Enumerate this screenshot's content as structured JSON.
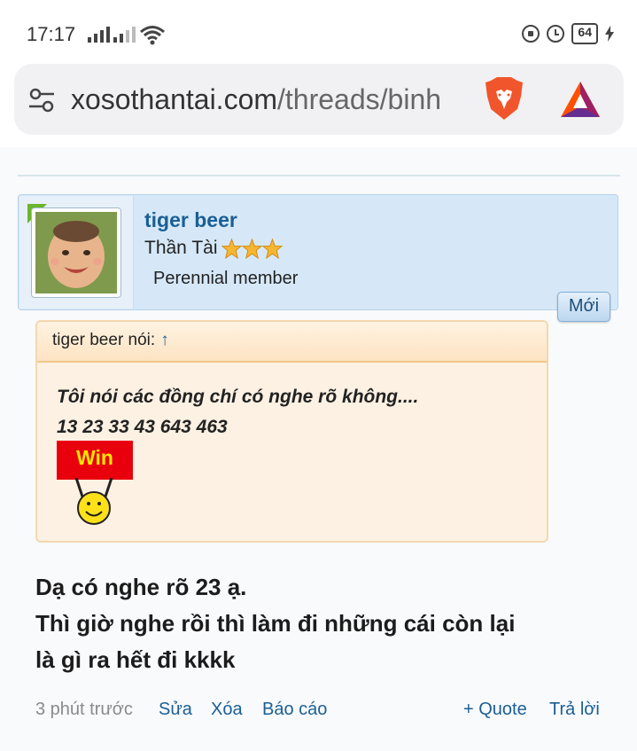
{
  "status_bar": {
    "time": "17:17",
    "battery": "64"
  },
  "browser": {
    "url_host": "xosothantai.com",
    "url_path": "/threads/binh"
  },
  "user": {
    "name": "tiger beer",
    "title": "Thần Tài",
    "star_count": 3,
    "member_type": "Perennial member",
    "new_badge": "Mới"
  },
  "quote": {
    "attribution": "tiger beer nói:",
    "arrow": "↑",
    "line1": "Tôi nói các đồng chí có nghe rõ không....",
    "line2": "13 23 33 43 643 463",
    "win_label": "Win"
  },
  "post": {
    "line1": "Dạ có nghe rõ 23 ạ.",
    "line2": "Thì giờ nghe rồi thì làm đi những cái còn lại",
    "line3": "là gì ra hết đi kkkk"
  },
  "footer": {
    "time": "3 phút trước",
    "edit": "Sửa",
    "delete": "Xóa",
    "report": "Báo cáo",
    "quote": "+ Quote",
    "reply": "Trả lời"
  },
  "colors": {
    "accent": "#1a5f95",
    "user_card": "#d6e8f8",
    "quote_bg": "#fdf1e3"
  }
}
